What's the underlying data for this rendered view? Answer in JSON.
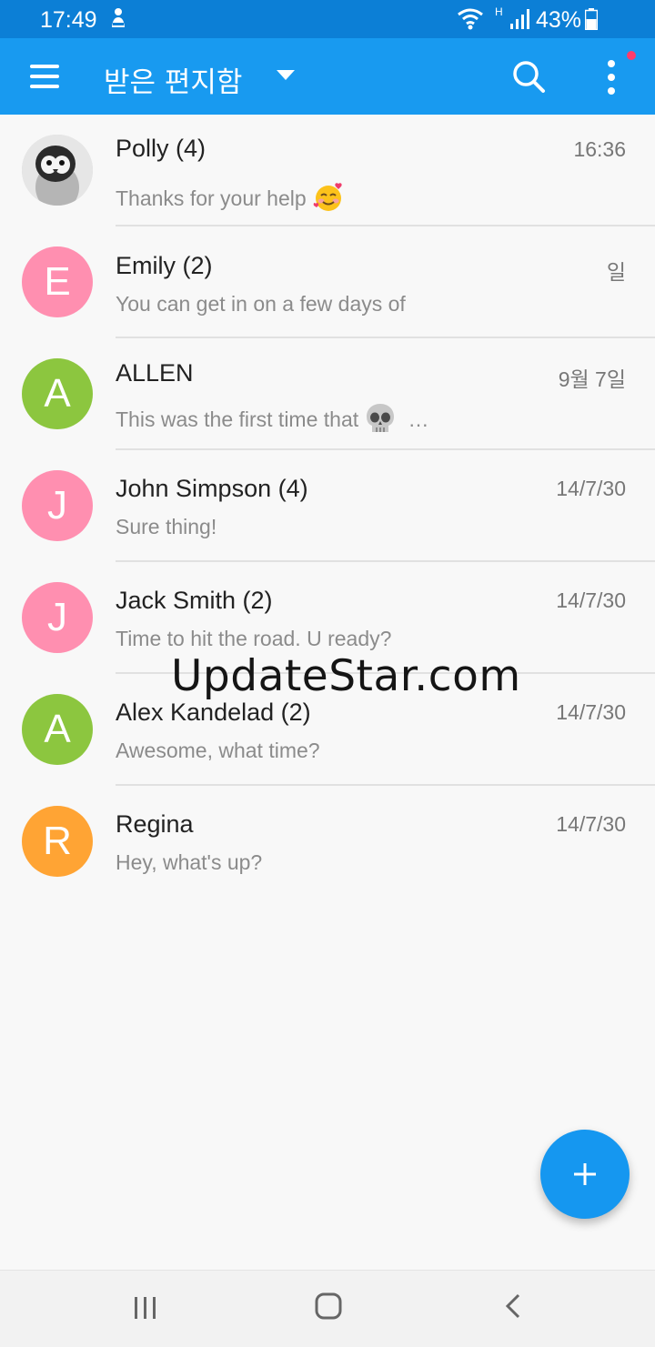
{
  "status_bar": {
    "time": "17:49",
    "network_type": "H",
    "battery": "43%"
  },
  "app_bar": {
    "title": "받은 편지함",
    "menu_icon": "hamburger-menu-icon",
    "dropdown_icon": "dropdown-arrow-icon",
    "search_icon": "search-icon",
    "more_icon": "more-vertical-icon",
    "color": "#189af0"
  },
  "conversations": [
    {
      "name": "Polly (4)",
      "date": "16:36",
      "preview": "Thanks for your help",
      "avatar_letter": "",
      "avatar_color": "#d8d8d8",
      "preview_emoji": "smiling-face-with-hearts-emoji"
    },
    {
      "name": "Emily (2)",
      "date": "일",
      "preview": "You can get in on a few days of",
      "avatar_letter": "E",
      "avatar_color": "#ff8fb0"
    },
    {
      "name": "ALLEN",
      "date": "9월 7일",
      "preview": "This was the first time that",
      "preview_suffix": "…",
      "avatar_letter": "A",
      "avatar_color": "#8cc63f",
      "preview_emoji": "skull-emoji"
    },
    {
      "name": "John Simpson (4)",
      "date": "14/7/30",
      "preview": "Sure thing!",
      "avatar_letter": "J",
      "avatar_color": "#ff8fb0"
    },
    {
      "name": "Jack Smith (2)",
      "date": "14/7/30",
      "preview": "Time to hit the road. U ready?",
      "avatar_letter": "J",
      "avatar_color": "#ff8fb0"
    },
    {
      "name": "Alex Kandelad (2)",
      "date": "14/7/30",
      "preview": "Awesome, what time?",
      "avatar_letter": "A",
      "avatar_color": "#8cc63f"
    },
    {
      "name": "Regina",
      "date": "14/7/30",
      "preview": "Hey, what's up?",
      "avatar_letter": "R",
      "avatar_color": "#ffa434"
    }
  ],
  "watermark": "UpdateStar.com",
  "fab": {
    "icon": "plus-icon",
    "color": "#1597f0"
  },
  "nav_bar": {
    "recents_icon": "recents-icon",
    "home_icon": "home-icon",
    "back_icon": "back-icon"
  }
}
